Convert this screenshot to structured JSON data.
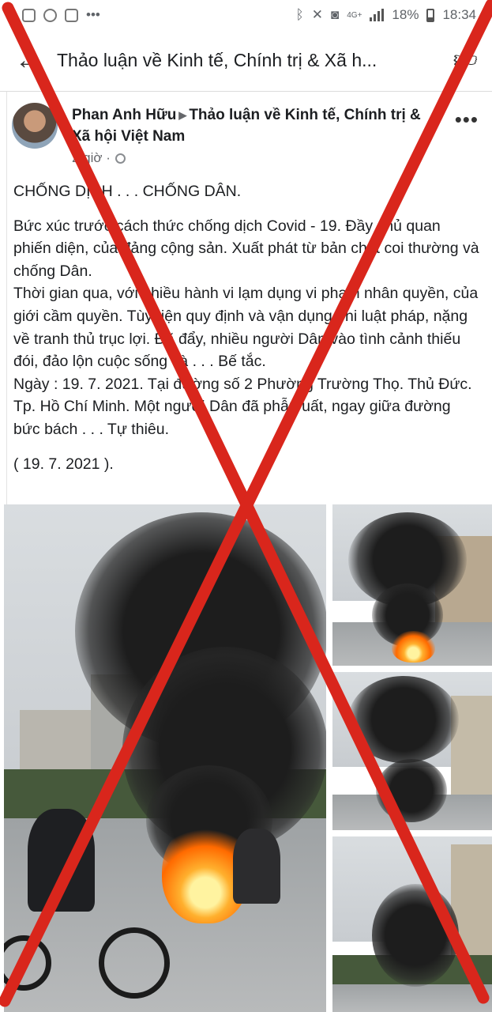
{
  "status_bar": {
    "battery": "18%",
    "time": "18:34",
    "network": "4G+"
  },
  "header": {
    "title": "Thảo luận về Kinh tế, Chính trị & Xã h...",
    "back_icon": "back-arrow-icon",
    "like_icon": "thumbs-up-icon"
  },
  "post": {
    "author": "Phan Anh Hữu",
    "group": "Thảo luận về Kinh tế, Chính trị & Xã hội Việt Nam",
    "time": "2 giờ ·",
    "body": {
      "line1": "CHỐNG DỊCH . . . CHỐNG DÂN.",
      "para1": "Bức xúc trước cách thức chống dịch Covid - 19. Đầy chủ quan phiến diện, của đảng cộng sản. Xuất phát từ bản chất coi thường và chống Dân.",
      "para2": "Thời gian qua, với nhiều hành vi lạm dụng vi phạm nhân quyền, của giới cầm quyền. Tùy tiện quy định và vận dụng phi luật pháp, nặng về tranh thủ trục lợi. Đã đẩy, nhiều người Dân vào tình cảnh thiếu đói, đảo lộn cuộc sống và . . . Bế tắc.",
      "para3": "Ngày : 19. 7. 2021. Tại đường số 2 Phường Trường Thọ. Thủ Đức. Tp. Hồ Chí Minh. Một người Dân đã phẫn uất, ngay giữa đường bức bách . . . Tự thiêu.",
      "date": "( 19. 7. 2021 )."
    }
  },
  "colors": {
    "cross": "#d9261c",
    "text": "#1c1e21",
    "meta": "#65676b"
  }
}
